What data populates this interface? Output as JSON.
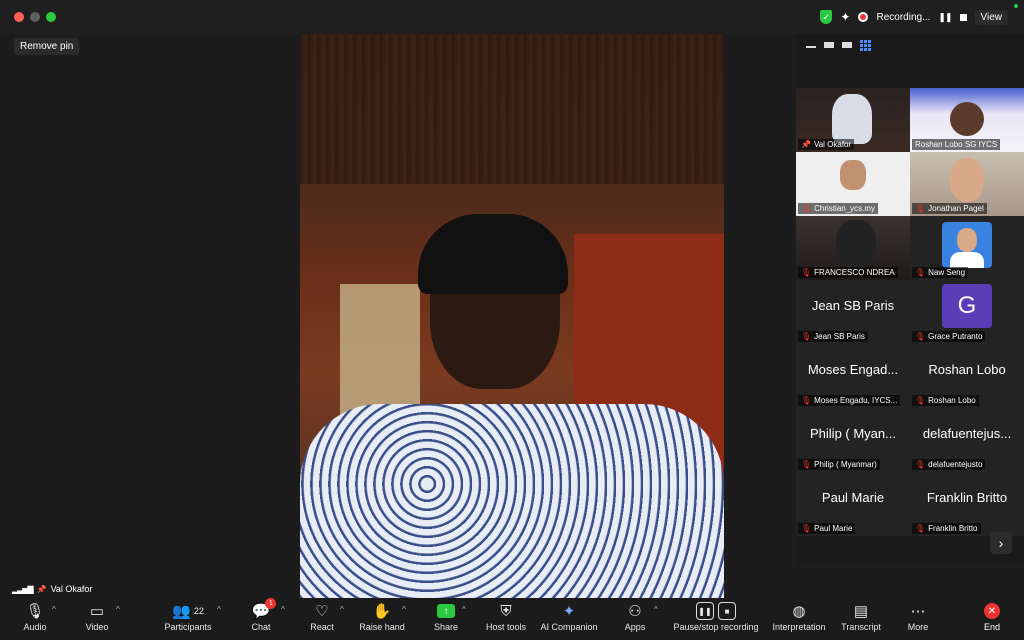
{
  "window": {
    "recording_label": "Recording...",
    "view_label": "View"
  },
  "stage": {
    "remove_pin_label": "Remove pin",
    "active_speaker_name": "Val Okafor"
  },
  "gallery": {
    "tiles": [
      {
        "name": "Val Okafor",
        "display": "",
        "active": true,
        "pinned": true
      },
      {
        "name": "Roshan Lobo SG IYCS",
        "display": ""
      },
      {
        "name": "Christian_ycs.my",
        "display": ""
      },
      {
        "name": "Jonathan Pagel",
        "display": ""
      },
      {
        "name": "FRANCESCO NDREA",
        "display": ""
      },
      {
        "name": "Naw Seng",
        "display": ""
      },
      {
        "name": "Jean SB Paris",
        "display": "Jean SB Paris"
      },
      {
        "name": "Grace Putranto",
        "display": "",
        "avatar_letter": "G"
      },
      {
        "name": "Moses Engadu, IYCS...",
        "display": "Moses Engad..."
      },
      {
        "name": "Roshan Lobo",
        "display": "Roshan Lobo"
      },
      {
        "name": "Philip ( Myanmar)",
        "display": "Philip ( Myan..."
      },
      {
        "name": "delafuentejusto",
        "display": "delafuentejus..."
      },
      {
        "name": "Paul Marie",
        "display": "Paul Marie"
      },
      {
        "name": "Franklin Britto",
        "display": "Franklin Britto"
      }
    ]
  },
  "toolbar": {
    "audio": "Audio",
    "video": "Video",
    "participants": "Participants",
    "participants_count": "22",
    "chat": "Chat",
    "chat_badge": "1",
    "react": "React",
    "raise_hand": "Raise hand",
    "share": "Share",
    "host_tools": "Host tools",
    "ai_companion": "AI Companion",
    "apps": "Apps",
    "pause_stop_recording": "Pause/stop recording",
    "interpretation": "Interpretation",
    "transcript": "Transcript",
    "more": "More",
    "end": "End"
  },
  "colors": {
    "accent_green": "#2ac940",
    "end_red": "#e33333",
    "avatar_purple": "#5b3db8"
  }
}
